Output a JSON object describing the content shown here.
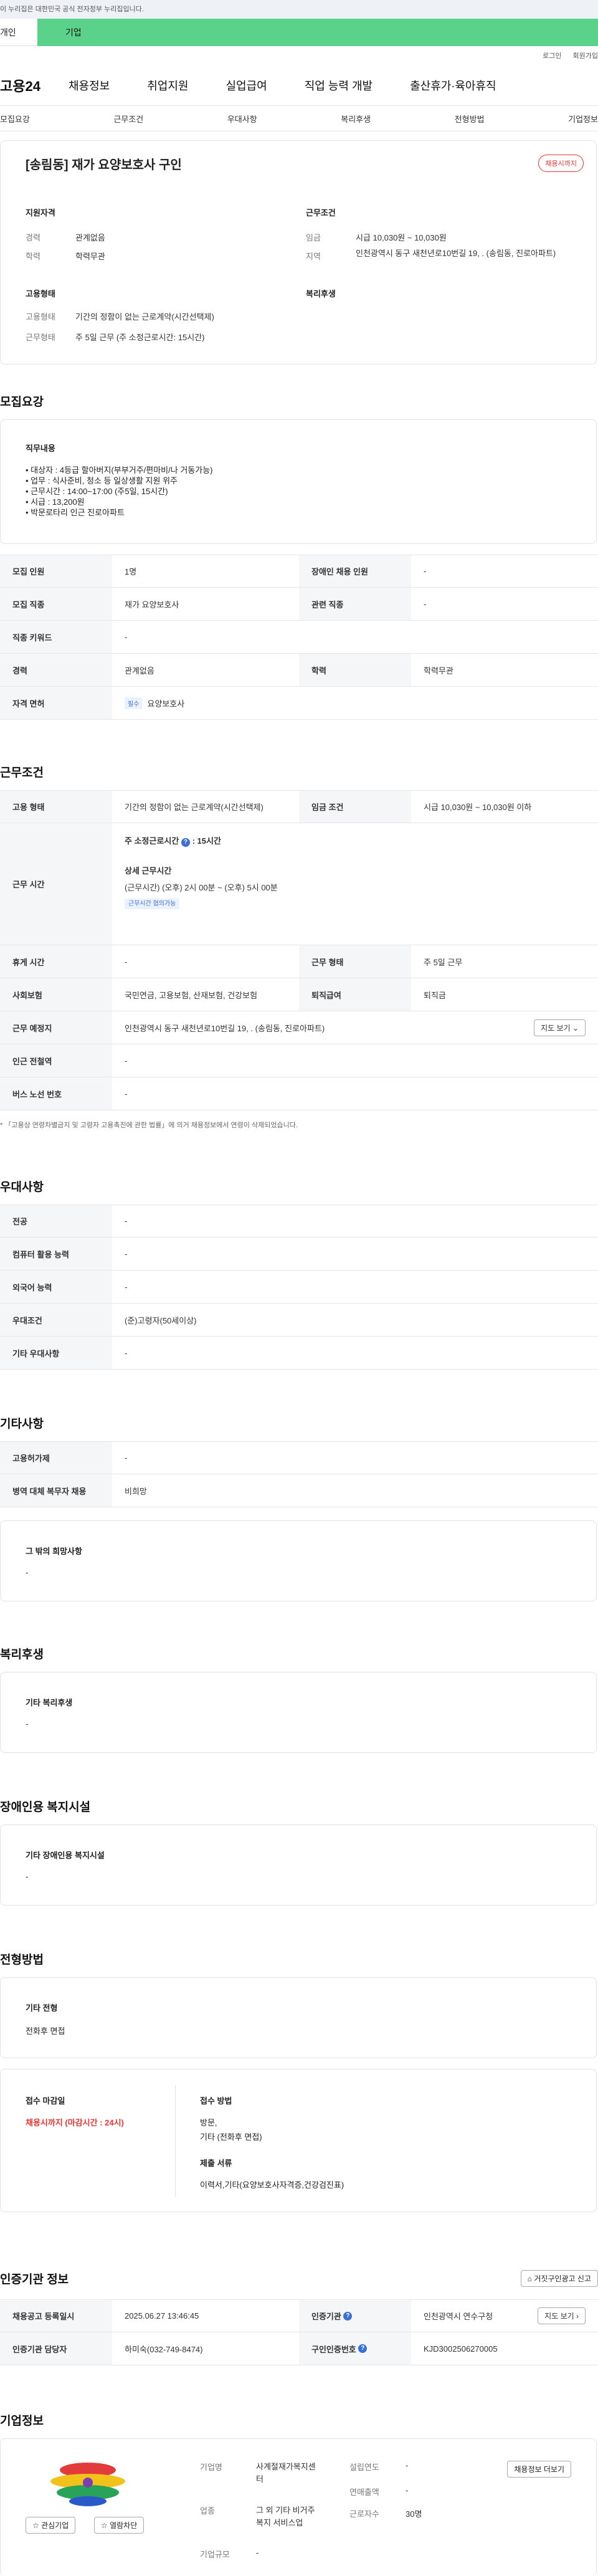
{
  "gov_banner": "이 누리집은 대한민국 공식 전자정부 누리집입니다.",
  "top_tabs": [
    "개인",
    "기업"
  ],
  "util": [
    "로그인",
    "회원가입"
  ],
  "logo": "고용24",
  "gnb": [
    "채용정보",
    "취업지원",
    "실업급여",
    "직업 능력 개발",
    "출산휴가·육아휴직"
  ],
  "lnb": [
    "모집요강",
    "근무조건",
    "우대사항",
    "복리후생",
    "전형방법",
    "기업정보"
  ],
  "job": {
    "title": "[송림동] 재가 요양보호사 구인",
    "status": "채용시까지",
    "qual_h": "지원자격",
    "career_k": "경력",
    "career_v": "관계없음",
    "edu_k": "학력",
    "edu_v": "학력무관",
    "cond_h": "근무조건",
    "wage_k": "임금",
    "wage_v": "시급 10,030원 ~ 10,030원",
    "loc_k": "지역",
    "loc_v": "인천광역시 동구 새천년로10번길 19, . (송림동, 진로아파트)",
    "emp_h": "고용형태",
    "emptype_k": "고용형태",
    "emptype_v": "기간의 정함이 없는 근로계약(시간선택제)",
    "work_k": "근무형태",
    "work_v": "주 5일 근무 (주 소정근로시간: 15시간)",
    "welfare_h": "복리후생"
  },
  "recruit": {
    "h": "모집요강",
    "duty_h": "직무내용",
    "duty_lines": [
      "• 대상자 : 4등급 할아버지(부부거주/편마비/나 거동가능)",
      "• 업무 : 식사준비, 청소 등 일상생활 지원 위주",
      "• 근무시간 : 14:00~17:00 (주5일, 15시간)",
      "• 시급 : 13,200원",
      "• 박문로타리 인근 진로아파트"
    ],
    "rows": [
      [
        "모집 인원",
        "1명",
        "장애인 채용 인원",
        "-"
      ],
      [
        "모집 직종",
        "재가 요양보호사",
        "관련 직종",
        "-"
      ],
      [
        "직종 키워드",
        "-",
        "",
        ""
      ],
      [
        "경력",
        "관계없음",
        "학력",
        "학력무관"
      ],
      [
        "자격 면허",
        "요양보호사",
        "",
        ""
      ]
    ],
    "required": "필수"
  },
  "cond": {
    "h": "근무조건",
    "emp_k": "고용 형태",
    "emp_v": "기간의 정함이 없는 근로계약(시간선택제)",
    "wage_k": "임금 조건",
    "wage_v": "시급 10,030원 ~ 10,030원 이하",
    "hours_k": "근무 시간",
    "hours_week": "주 소정근로시간",
    "hours_week_v": "15시간",
    "detail_h": "상세 근무시간",
    "detail_v": "(근무시간) (오후) 2시 00분 ~ (오후) 5시 00분",
    "flex_tag": "근무시간 협의가능",
    "rest_k": "휴게 시간",
    "rest_v": "-",
    "form_k": "근무 형태",
    "form_v": "주 5일 근무",
    "ins_k": "사회보험",
    "ins_v": "국민연금, 고용보험, 산재보험, 건강보험",
    "sev_k": "퇴직급여",
    "sev_v": "퇴직금",
    "place_k": "근무 예정지",
    "place_v": "인천광역시 동구 새천년로10번길 19, . (송림동, 진로아파트)",
    "map": "지도 보기",
    "subway_k": "인근 전철역",
    "subway_v": "-",
    "bus_k": "버스 노선 번호",
    "bus_v": "-",
    "note": "* 「고용상 연령차별금지 및 고령자 고용촉진에 관한 법률」에 의거 채용정보에서 연령이 삭제되었습니다."
  },
  "pref": {
    "h": "우대사항",
    "rows": [
      [
        "전공",
        "-"
      ],
      [
        "컴퓨터 활용 능력",
        "-"
      ],
      [
        "외국어 능력",
        "-"
      ],
      [
        "우대조건",
        "(준)고령자(50세이상)"
      ],
      [
        "기타 우대사항",
        "-"
      ]
    ]
  },
  "etc": {
    "h": "기타사항",
    "rows": [
      [
        "고용허가제",
        "-"
      ],
      [
        "병역 대체 복무자 채용",
        "비희망"
      ]
    ],
    "hope_h": "그 밖의 희망사항",
    "hope_v": "-"
  },
  "welfare": {
    "h": "복리후생",
    "sub": "기타 복리후생",
    "v": "-"
  },
  "disab": {
    "h": "장애인용 복지시설",
    "sub": "기타 장애인용 복지시설",
    "v": "-"
  },
  "select": {
    "h": "전형방법",
    "sub": "기타 전형",
    "v": "전화후 면접",
    "dl_h": "접수 마감일",
    "dl_v": "채용시까지 (마감시간 : 24시)",
    "method_h": "접수 방법",
    "method_v1": "방문,",
    "method_v2": "기타 (전화후 면접)",
    "docs_h": "제출 서류",
    "docs_v": "이력서,기타(요양보호사자격증,건강검진표)"
  },
  "cert": {
    "h": "인증기관 정보",
    "report": "거짓구인광고 신고",
    "reg_k": "채용공고 등록일시",
    "reg_v": "2025.06.27 13:46:45",
    "org_k": "인증기관",
    "org_v": "인천광역시 연수구청",
    "map": "지도 보기",
    "mgr_k": "인증기관 담당자",
    "mgr_v": "하미숙(032-749-8474)",
    "no_k": "구인인증번호",
    "no_v": "KJD3002506270005"
  },
  "company": {
    "h": "기업정보",
    "fav": "관심기업",
    "block": "열람차단",
    "name_k": "기업명",
    "name_v1": "사계절재가복지센",
    "name_v2": "터",
    "year_k": "설립연도",
    "year_v": "-",
    "ind_k": "업종",
    "ind_v1": "그 외 기타 비거주",
    "ind_v2": "복지 서비스업",
    "sales_k": "연매출액",
    "sales_v": "-",
    "emp_k": "근로자수",
    "emp_v": "30명",
    "size_k": "기업규모",
    "size_v": "-",
    "other_btn": "채용정보 더보기"
  }
}
